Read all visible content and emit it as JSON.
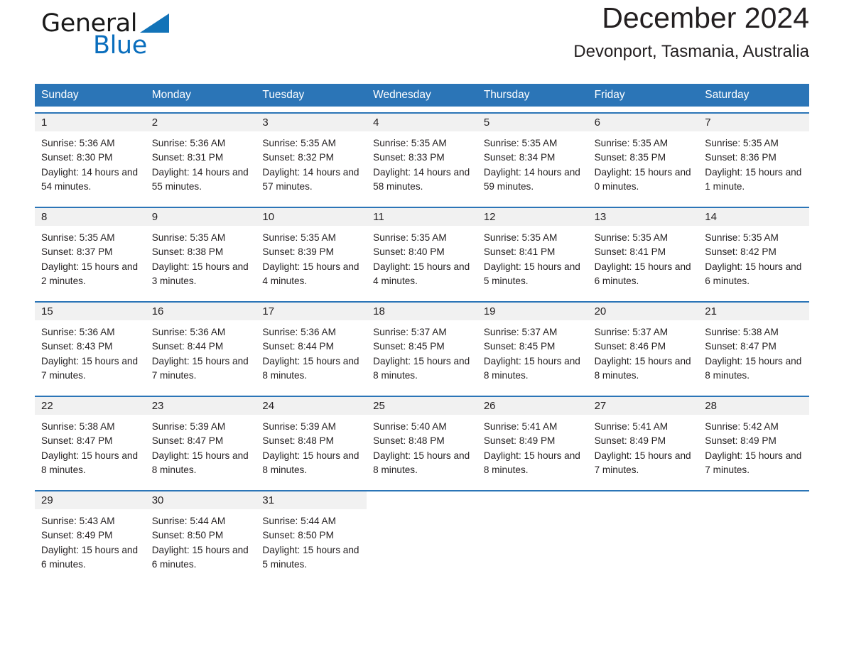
{
  "brand": {
    "name_part1": "General",
    "name_part2": "Blue",
    "triangle_color": "#1273b8",
    "blue_color": "#0a6ebd"
  },
  "header": {
    "title": "December 2024",
    "subtitle": "Devonport, Tasmania, Australia"
  },
  "theme": {
    "header_blue": "#2b75b7",
    "daynum_band": "#f1f1f1",
    "text": "#231f20"
  },
  "weekdays": [
    "Sunday",
    "Monday",
    "Tuesday",
    "Wednesday",
    "Thursday",
    "Friday",
    "Saturday"
  ],
  "weeks": [
    [
      {
        "day": "1",
        "sunrise": "Sunrise: 5:36 AM",
        "sunset": "Sunset: 8:30 PM",
        "daylight": "Daylight: 14 hours and 54 minutes."
      },
      {
        "day": "2",
        "sunrise": "Sunrise: 5:36 AM",
        "sunset": "Sunset: 8:31 PM",
        "daylight": "Daylight: 14 hours and 55 minutes."
      },
      {
        "day": "3",
        "sunrise": "Sunrise: 5:35 AM",
        "sunset": "Sunset: 8:32 PM",
        "daylight": "Daylight: 14 hours and 57 minutes."
      },
      {
        "day": "4",
        "sunrise": "Sunrise: 5:35 AM",
        "sunset": "Sunset: 8:33 PM",
        "daylight": "Daylight: 14 hours and 58 minutes."
      },
      {
        "day": "5",
        "sunrise": "Sunrise: 5:35 AM",
        "sunset": "Sunset: 8:34 PM",
        "daylight": "Daylight: 14 hours and 59 minutes."
      },
      {
        "day": "6",
        "sunrise": "Sunrise: 5:35 AM",
        "sunset": "Sunset: 8:35 PM",
        "daylight": "Daylight: 15 hours and 0 minutes."
      },
      {
        "day": "7",
        "sunrise": "Sunrise: 5:35 AM",
        "sunset": "Sunset: 8:36 PM",
        "daylight": "Daylight: 15 hours and 1 minute."
      }
    ],
    [
      {
        "day": "8",
        "sunrise": "Sunrise: 5:35 AM",
        "sunset": "Sunset: 8:37 PM",
        "daylight": "Daylight: 15 hours and 2 minutes."
      },
      {
        "day": "9",
        "sunrise": "Sunrise: 5:35 AM",
        "sunset": "Sunset: 8:38 PM",
        "daylight": "Daylight: 15 hours and 3 minutes."
      },
      {
        "day": "10",
        "sunrise": "Sunrise: 5:35 AM",
        "sunset": "Sunset: 8:39 PM",
        "daylight": "Daylight: 15 hours and 4 minutes."
      },
      {
        "day": "11",
        "sunrise": "Sunrise: 5:35 AM",
        "sunset": "Sunset: 8:40 PM",
        "daylight": "Daylight: 15 hours and 4 minutes."
      },
      {
        "day": "12",
        "sunrise": "Sunrise: 5:35 AM",
        "sunset": "Sunset: 8:41 PM",
        "daylight": "Daylight: 15 hours and 5 minutes."
      },
      {
        "day": "13",
        "sunrise": "Sunrise: 5:35 AM",
        "sunset": "Sunset: 8:41 PM",
        "daylight": "Daylight: 15 hours and 6 minutes."
      },
      {
        "day": "14",
        "sunrise": "Sunrise: 5:35 AM",
        "sunset": "Sunset: 8:42 PM",
        "daylight": "Daylight: 15 hours and 6 minutes."
      }
    ],
    [
      {
        "day": "15",
        "sunrise": "Sunrise: 5:36 AM",
        "sunset": "Sunset: 8:43 PM",
        "daylight": "Daylight: 15 hours and 7 minutes."
      },
      {
        "day": "16",
        "sunrise": "Sunrise: 5:36 AM",
        "sunset": "Sunset: 8:44 PM",
        "daylight": "Daylight: 15 hours and 7 minutes."
      },
      {
        "day": "17",
        "sunrise": "Sunrise: 5:36 AM",
        "sunset": "Sunset: 8:44 PM",
        "daylight": "Daylight: 15 hours and 8 minutes."
      },
      {
        "day": "18",
        "sunrise": "Sunrise: 5:37 AM",
        "sunset": "Sunset: 8:45 PM",
        "daylight": "Daylight: 15 hours and 8 minutes."
      },
      {
        "day": "19",
        "sunrise": "Sunrise: 5:37 AM",
        "sunset": "Sunset: 8:45 PM",
        "daylight": "Daylight: 15 hours and 8 minutes."
      },
      {
        "day": "20",
        "sunrise": "Sunrise: 5:37 AM",
        "sunset": "Sunset: 8:46 PM",
        "daylight": "Daylight: 15 hours and 8 minutes."
      },
      {
        "day": "21",
        "sunrise": "Sunrise: 5:38 AM",
        "sunset": "Sunset: 8:47 PM",
        "daylight": "Daylight: 15 hours and 8 minutes."
      }
    ],
    [
      {
        "day": "22",
        "sunrise": "Sunrise: 5:38 AM",
        "sunset": "Sunset: 8:47 PM",
        "daylight": "Daylight: 15 hours and 8 minutes."
      },
      {
        "day": "23",
        "sunrise": "Sunrise: 5:39 AM",
        "sunset": "Sunset: 8:47 PM",
        "daylight": "Daylight: 15 hours and 8 minutes."
      },
      {
        "day": "24",
        "sunrise": "Sunrise: 5:39 AM",
        "sunset": "Sunset: 8:48 PM",
        "daylight": "Daylight: 15 hours and 8 minutes."
      },
      {
        "day": "25",
        "sunrise": "Sunrise: 5:40 AM",
        "sunset": "Sunset: 8:48 PM",
        "daylight": "Daylight: 15 hours and 8 minutes."
      },
      {
        "day": "26",
        "sunrise": "Sunrise: 5:41 AM",
        "sunset": "Sunset: 8:49 PM",
        "daylight": "Daylight: 15 hours and 8 minutes."
      },
      {
        "day": "27",
        "sunrise": "Sunrise: 5:41 AM",
        "sunset": "Sunset: 8:49 PM",
        "daylight": "Daylight: 15 hours and 7 minutes."
      },
      {
        "day": "28",
        "sunrise": "Sunrise: 5:42 AM",
        "sunset": "Sunset: 8:49 PM",
        "daylight": "Daylight: 15 hours and 7 minutes."
      }
    ],
    [
      {
        "day": "29",
        "sunrise": "Sunrise: 5:43 AM",
        "sunset": "Sunset: 8:49 PM",
        "daylight": "Daylight: 15 hours and 6 minutes."
      },
      {
        "day": "30",
        "sunrise": "Sunrise: 5:44 AM",
        "sunset": "Sunset: 8:50 PM",
        "daylight": "Daylight: 15 hours and 6 minutes."
      },
      {
        "day": "31",
        "sunrise": "Sunrise: 5:44 AM",
        "sunset": "Sunset: 8:50 PM",
        "daylight": "Daylight: 15 hours and 5 minutes."
      },
      {
        "day": "",
        "sunrise": "",
        "sunset": "",
        "daylight": ""
      },
      {
        "day": "",
        "sunrise": "",
        "sunset": "",
        "daylight": ""
      },
      {
        "day": "",
        "sunrise": "",
        "sunset": "",
        "daylight": ""
      },
      {
        "day": "",
        "sunrise": "",
        "sunset": "",
        "daylight": ""
      }
    ]
  ]
}
